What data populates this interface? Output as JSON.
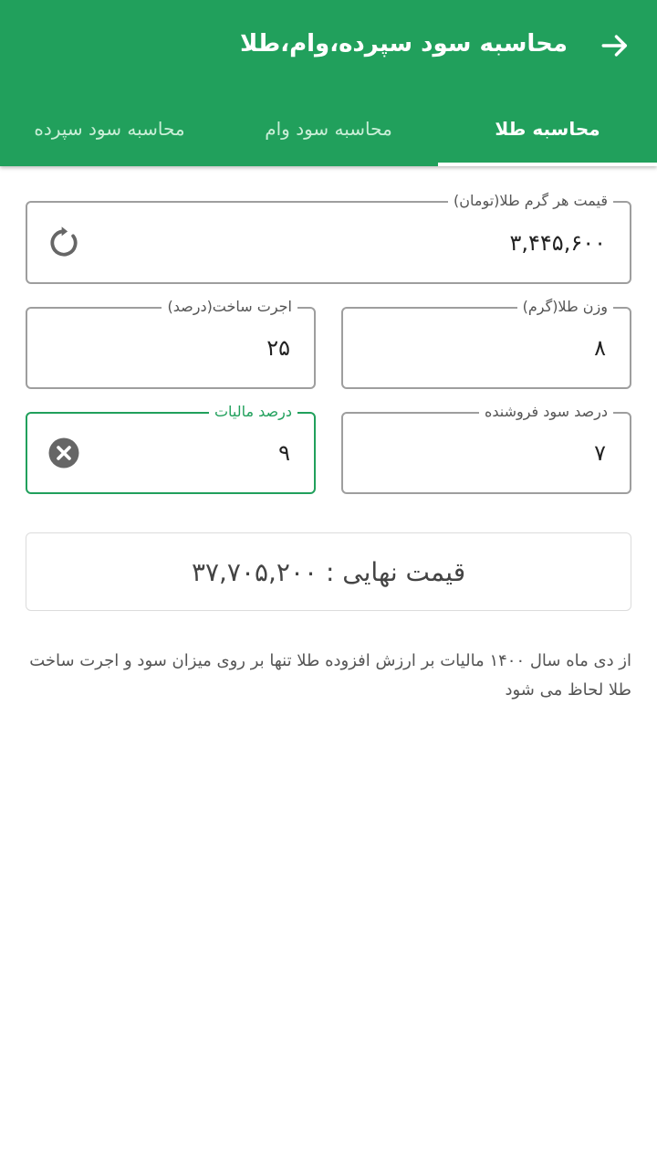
{
  "appbar": {
    "title": "محاسبه سود سپرده،وام،طلا",
    "back_icon": "arrow-right-icon",
    "color": "#21a05c"
  },
  "tabs": [
    {
      "label": "محاسبه طلا",
      "active": true
    },
    {
      "label": "محاسبه سود وام",
      "active": false
    },
    {
      "label": "محاسبه سود سپرده",
      "active": false
    }
  ],
  "form": {
    "gold_price": {
      "label": "قیمت هر گرم طلا(تومان)",
      "value": "۳,۴۴۵,۶۰۰",
      "icon": "refresh-icon"
    },
    "weight": {
      "label": "وزن طلا(گرم)",
      "value": "۸"
    },
    "making_fee": {
      "label": "اجرت ساخت(درصد)",
      "value": "۲۵"
    },
    "seller_profit": {
      "label": "درصد سود فروشنده",
      "value": "۷"
    },
    "tax": {
      "label": "درصد مالیات",
      "value": "۹",
      "icon": "clear-icon"
    }
  },
  "result": {
    "text": "قیمت نهایی : ۳۷,۷۰۵,۲۰۰"
  },
  "note": {
    "text": "از دی ماه سال ۱۴۰۰ مالیات بر ارزش افزوده طلا تنها بر روی میزان سود و اجرت ساخت طلا لحاظ می شود"
  }
}
